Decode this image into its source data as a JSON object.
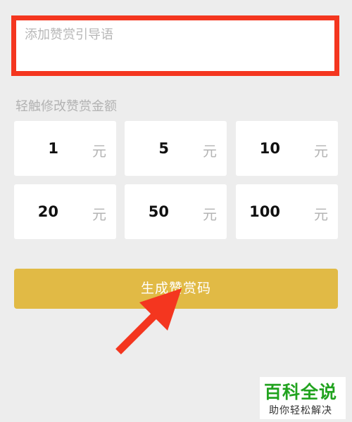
{
  "guide": {
    "placeholder": "添加赞赏引导语"
  },
  "amount_hint": "轻触修改赞赏金额",
  "amounts": [
    {
      "value": "1",
      "unit": "元"
    },
    {
      "value": "5",
      "unit": "元"
    },
    {
      "value": "10",
      "unit": "元"
    },
    {
      "value": "20",
      "unit": "元"
    },
    {
      "value": "50",
      "unit": "元"
    },
    {
      "value": "100",
      "unit": "元"
    }
  ],
  "generate_button": "生成赞赏码",
  "watermark": {
    "title": "百科全说",
    "subtitle": "助你轻松解决"
  },
  "colors": {
    "highlight": "#f4361f",
    "button": "#e1ba45",
    "arrow": "#f4361f",
    "watermark_green": "#21a31f"
  }
}
